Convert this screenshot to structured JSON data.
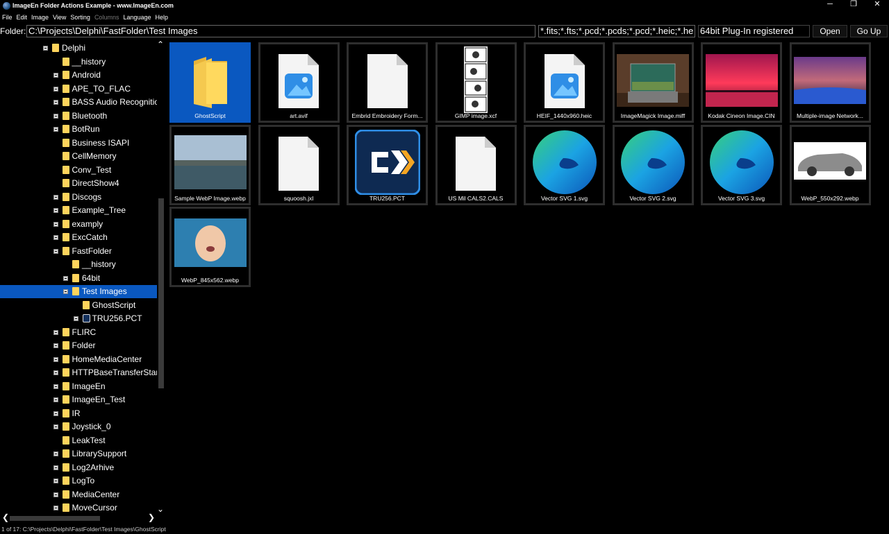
{
  "window": {
    "title": "ImageEn Folder Actions Example - www.ImageEn.com",
    "controls": {
      "minimize": "─",
      "maximize": "❐",
      "close": "✕"
    }
  },
  "menu": [
    "File",
    "Edit",
    "Image",
    "View",
    "Sorting",
    "Columns",
    "Language",
    "Help"
  ],
  "menu_disabled": [
    "Columns"
  ],
  "toolbar": {
    "folder_label": "Folder:",
    "folder_path": "C:\\Projects\\Delphi\\FastFolder\\Test Images",
    "file_filter": "*.fits;*.fts;*.pcd;*.pcds;*.pcd;*.heic;*.he",
    "plugin_status": "64bit Plug-In registered",
    "open_label": "Open",
    "go_up_label": "Go Up"
  },
  "tree": [
    {
      "label": "Delphi",
      "indent": 0,
      "expander": true,
      "icon": "folder"
    },
    {
      "label": "__history",
      "indent": 1,
      "expander": false,
      "icon": "folder"
    },
    {
      "label": "Android",
      "indent": 1,
      "expander": true,
      "icon": "folder"
    },
    {
      "label": "APE_TO_FLAC",
      "indent": 1,
      "expander": true,
      "icon": "folder"
    },
    {
      "label": "BASS Audio Recognition",
      "indent": 1,
      "expander": true,
      "icon": "folder"
    },
    {
      "label": "Bluetooth",
      "indent": 1,
      "expander": true,
      "icon": "folder"
    },
    {
      "label": "BotRun",
      "indent": 1,
      "expander": true,
      "icon": "folder"
    },
    {
      "label": "Business ISAPI",
      "indent": 1,
      "expander": false,
      "icon": "folder"
    },
    {
      "label": "CellMemory",
      "indent": 1,
      "expander": false,
      "icon": "folder"
    },
    {
      "label": "Conv_Test",
      "indent": 1,
      "expander": false,
      "icon": "folder"
    },
    {
      "label": "DirectShow4",
      "indent": 1,
      "expander": false,
      "icon": "folder"
    },
    {
      "label": "Discogs",
      "indent": 1,
      "expander": true,
      "icon": "folder"
    },
    {
      "label": "Example_Tree",
      "indent": 1,
      "expander": true,
      "icon": "folder"
    },
    {
      "label": "examply",
      "indent": 1,
      "expander": true,
      "icon": "folder"
    },
    {
      "label": "ExcCatch",
      "indent": 1,
      "expander": true,
      "icon": "folder"
    },
    {
      "label": "FastFolder",
      "indent": 1,
      "expander": true,
      "icon": "folder"
    },
    {
      "label": "__history",
      "indent": 2,
      "expander": false,
      "icon": "folder"
    },
    {
      "label": "64bit",
      "indent": 2,
      "expander": true,
      "icon": "folder"
    },
    {
      "label": "Test Images",
      "indent": 2,
      "expander": true,
      "icon": "folder",
      "selected": true
    },
    {
      "label": "GhostScript",
      "indent": 3,
      "expander": false,
      "icon": "folder"
    },
    {
      "label": "TRU256.PCT",
      "indent": 3,
      "expander": true,
      "icon": "file"
    },
    {
      "label": "FLIRC",
      "indent": 1,
      "expander": true,
      "icon": "folder"
    },
    {
      "label": "Folder",
      "indent": 1,
      "expander": true,
      "icon": "folder"
    },
    {
      "label": "HomeMediaCenter",
      "indent": 1,
      "expander": true,
      "icon": "folder"
    },
    {
      "label": "HTTPBaseTransferStart",
      "indent": 1,
      "expander": true,
      "icon": "folder"
    },
    {
      "label": "ImageEn",
      "indent": 1,
      "expander": true,
      "icon": "folder"
    },
    {
      "label": "ImageEn_Test",
      "indent": 1,
      "expander": true,
      "icon": "folder"
    },
    {
      "label": "IR",
      "indent": 1,
      "expander": true,
      "icon": "folder"
    },
    {
      "label": "Joystick_0",
      "indent": 1,
      "expander": true,
      "icon": "folder"
    },
    {
      "label": "LeakTest",
      "indent": 1,
      "expander": false,
      "icon": "folder"
    },
    {
      "label": "LibrarySupport",
      "indent": 1,
      "expander": true,
      "icon": "folder"
    },
    {
      "label": "Log2Arhive",
      "indent": 1,
      "expander": true,
      "icon": "folder"
    },
    {
      "label": "LogTo",
      "indent": 1,
      "expander": true,
      "icon": "folder"
    },
    {
      "label": "MediaCenter",
      "indent": 1,
      "expander": true,
      "icon": "folder"
    },
    {
      "label": "MoveCursor",
      "indent": 1,
      "expander": true,
      "icon": "folder"
    }
  ],
  "files": [
    {
      "name": "GhostScript",
      "thumb": "folder-icon",
      "selected": true
    },
    {
      "name": "art.avif",
      "thumb": "image-file-icon"
    },
    {
      "name": "Embrid Embroidery Form...",
      "thumb": "blank-file-icon"
    },
    {
      "name": "GIMP image.xcf",
      "thumb": "comic-strip-thumbnail"
    },
    {
      "name": "HEIF_1440x960.heic",
      "thumb": "image-file-icon"
    },
    {
      "name": "ImageMagick Image.miff",
      "thumb": "aquarium-thumbnail"
    },
    {
      "name": "Kodak Cineon Image.CIN",
      "thumb": "sunset-thumbnail"
    },
    {
      "name": "Multiple-image Network...",
      "thumb": "night-sky-thumbnail"
    },
    {
      "name": "Sample WebP Image.webp",
      "thumb": "harbor-thumbnail"
    },
    {
      "name": "squoosh.jxl",
      "thumb": "blank-file-icon"
    },
    {
      "name": "TRU256.PCT",
      "thumb": "tru256-logo-thumbnail"
    },
    {
      "name": "US Mil CALS2.CALS",
      "thumb": "blank-file-icon"
    },
    {
      "name": "Vector SVG 1.svg",
      "thumb": "edge-logo-thumbnail"
    },
    {
      "name": "Vector SVG 2.svg",
      "thumb": "edge-logo-thumbnail"
    },
    {
      "name": "Vector SVG 3.svg",
      "thumb": "edge-logo-thumbnail"
    },
    {
      "name": "WebP_550x292.webp",
      "thumb": "car-thumbnail"
    },
    {
      "name": "WebP_845x562.webp",
      "thumb": "baby-thumbnail"
    }
  ],
  "status": "1 of 17: C:\\Projects\\Delphi\\FastFolder\\Test Images\\GhostScript",
  "colors": {
    "selection": "#0a58c0",
    "folder": "#ffd45c",
    "background": "#000000"
  }
}
